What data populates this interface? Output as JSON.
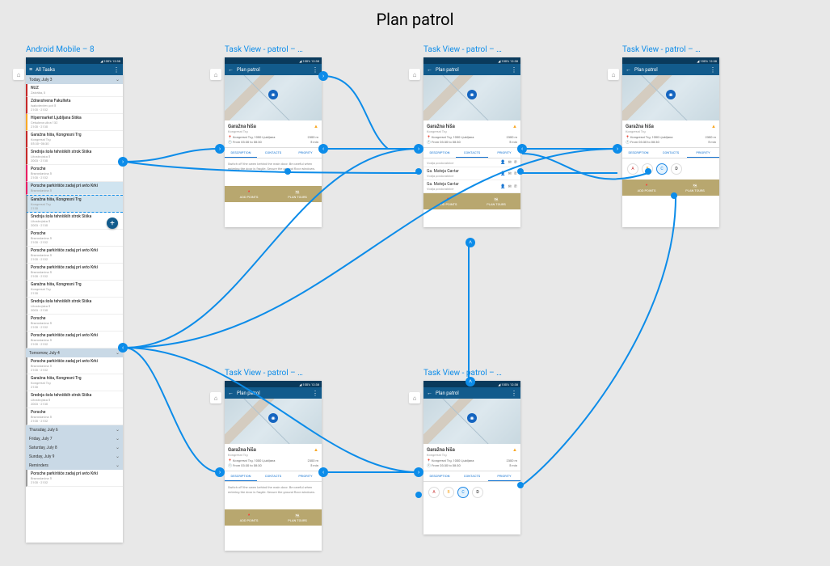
{
  "canvas": {
    "title": "Plan patrol"
  },
  "statusbar": {
    "time": "12:38",
    "carrier": "100%"
  },
  "frames": {
    "list": {
      "label": "Android Mobile – 8",
      "appbar_title": "All Tasks",
      "dates": [
        {
          "label": "Today, July 3"
        },
        {
          "label": "Tomorrow, July 4"
        },
        {
          "label": "Thursday, July 6"
        },
        {
          "label": "Friday, July 7"
        },
        {
          "label": "Saturday, July 8"
        },
        {
          "label": "Sunday, July 9"
        },
        {
          "label": "Reminders"
        }
      ],
      "today_tasks": [
        {
          "title": "NUZ",
          "sub": "Zaloška, 0",
          "time": "",
          "c": "red"
        },
        {
          "title": "Zdravstvena Fakulteta",
          "sub": "Isakotevčev pot 5",
          "time": "2100 - 2102",
          "c": "red"
        },
        {
          "title": "Hipermarket Ljubljana Šiška",
          "sub": "Cekulova ulica 132",
          "time": "2100 - 2130",
          "c": "yellow"
        },
        {
          "title": "Garažna hiša, Kongresni Trg",
          "sub": "Kongresni Trg",
          "time": "05:30–08:30",
          "c": "red"
        },
        {
          "title": "Srednja šola tehniških strok Šiška",
          "sub": "Litostrojska 5",
          "time": "2003 - 2130",
          "c": "red"
        },
        {
          "title": "Porsche",
          "sub": "Bravoslavina 5",
          "time": "2100 - 2102",
          "c": "pink"
        },
        {
          "title": "Porsche parkirišče zadaj pri avto Krki",
          "sub": "Bravoslavina 5",
          "time": "",
          "c": "pink",
          "hl": true
        },
        {
          "title": "Garažna hiša, Kongresni Trg",
          "sub": "Kongresni Trg",
          "time": "2130",
          "c": "gray",
          "dashed": true
        },
        {
          "title": "Srednja šola tehniških strok Šiška",
          "sub": "Litostrojska 5",
          "time": "2003 - 2130",
          "c": "gray"
        },
        {
          "title": "Porsche",
          "sub": "Bravoslavina 5",
          "time": "2100 - 2102",
          "c": "gray"
        },
        {
          "title": "Porsche parkirišče zadaj pri avto Krki",
          "sub": "Bravoslavina 5",
          "time": "2100 - 2102",
          "c": "gray"
        },
        {
          "title": "Porsche parkirišče zadaj pri avto Krki",
          "sub": "Bravoslavina 5",
          "time": "2100 - 2102",
          "c": "gray"
        },
        {
          "title": "Garažna hiša, Kongresni Trg",
          "sub": "Kongresni Trg",
          "time": "2130",
          "c": "gray"
        },
        {
          "title": "Srednja šola tehniških strok Šiška",
          "sub": "Litostrojska 5",
          "time": "2003 - 2130",
          "c": "gray"
        },
        {
          "title": "Porsche",
          "sub": "Bravoslavina 5",
          "time": "2100 - 2102",
          "c": "gray"
        },
        {
          "title": "Porsche parkirišče zadaj pri avto Krki",
          "sub": "Bravoslavina 5",
          "time": "2100 - 2102",
          "c": "gray"
        }
      ],
      "tomorrow_tasks": [
        {
          "title": "Porsche parkirišče zadaj pri avto Krki",
          "sub": "Bravoslavina 5",
          "time": "2100 - 2102",
          "c": "gray"
        },
        {
          "title": "Garažna hiša, Kongresni Trg",
          "sub": "Kongresni Trg",
          "time": "2130",
          "c": "gray"
        },
        {
          "title": "Srednja šola tehniških strok Šiška",
          "sub": "Litostrojska 5",
          "time": "2003 - 2130",
          "c": "gray"
        },
        {
          "title": "Porsche",
          "sub": "Bravoslavina 5",
          "time": "2100 - 2102",
          "c": "gray"
        }
      ],
      "reminder_tasks": [
        {
          "title": "Porsche parkirišče zadaj pri avto Krki",
          "sub": "Bravoslavina 5",
          "time": "2100 - 2102",
          "c": "gray"
        }
      ]
    },
    "taskview": {
      "label": "Task View - patrol – …",
      "appbar_title": "Plan patrol",
      "place_title": "Garažna hiša",
      "place_sub": "Kongresni Trg",
      "addr": "Kongresni Trg, 1000 Ljubljana",
      "distance": "2300 m",
      "timewin": "From 03:30 to 08:30",
      "eta": "5 min",
      "tabs": {
        "desc": "DESCRIPTION",
        "contacts": "CONTACTS",
        "priority": "PRIORITY"
      },
      "description": "Switch off the owen behind the main door. Be careful when entering the door is fragile. Secure the ground floor windows.",
      "contacts": [
        {
          "name": "",
          "role": "Vodja poslovalnice"
        },
        {
          "name": "Ga. Mateja Gavtar",
          "role": "Vodja poslovalnice"
        },
        {
          "name": "Ga. Mateja Gavtar",
          "role": "Vodja poslovalnice"
        }
      ],
      "priorities": [
        "A",
        "B",
        "C",
        "D"
      ],
      "actions": {
        "add": "ADD POINTS",
        "plan": "PLAN TOURS"
      }
    }
  }
}
